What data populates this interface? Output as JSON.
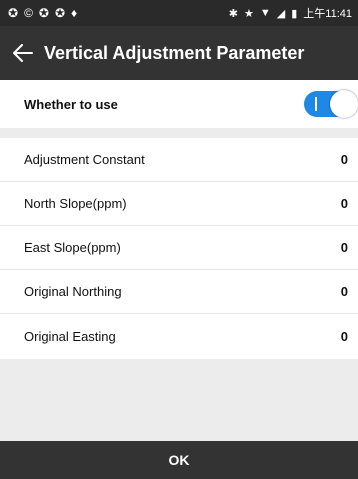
{
  "status_bar": {
    "left_icons": [
      "notification-icon",
      "notification-icon",
      "notification-icon",
      "notification-icon",
      "location-pin-icon"
    ],
    "right_icons": [
      "bluetooth-icon",
      "star-icon",
      "wifi-icon",
      "signal-icon",
      "battery-icon"
    ],
    "time": "上午11:41"
  },
  "app_bar": {
    "back_icon": "arrow-left-icon",
    "title": "Vertical Adjustment Parameter"
  },
  "toggle_row": {
    "label": "Whether to use",
    "state": "on",
    "accent_color": "#1e88e5"
  },
  "parameters": [
    {
      "label": "Adjustment Constant",
      "value": "0"
    },
    {
      "label": "North Slope(ppm)",
      "value": "0"
    },
    {
      "label": "East Slope(ppm)",
      "value": "0"
    },
    {
      "label": "Original Northing",
      "value": "0"
    },
    {
      "label": "Original Easting",
      "value": "0"
    }
  ],
  "footer": {
    "ok_label": "OK"
  }
}
